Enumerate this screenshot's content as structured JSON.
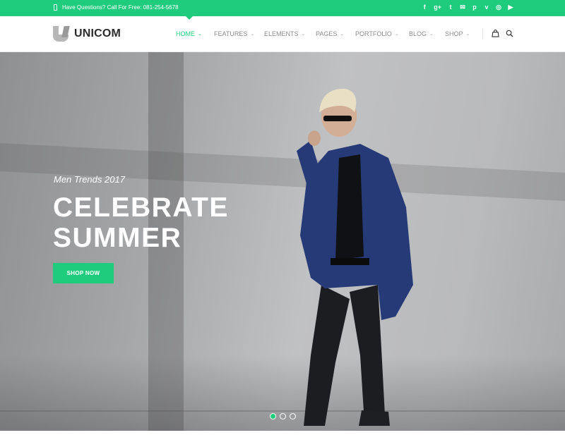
{
  "topbar": {
    "contact_text": "Have Questions? Call For Free: 081-254-5678",
    "socials": [
      {
        "name": "facebook-icon",
        "glyph": "f"
      },
      {
        "name": "google-plus-icon",
        "glyph": "g+"
      },
      {
        "name": "twitter-icon",
        "glyph": "t"
      },
      {
        "name": "email-icon",
        "glyph": "✉"
      },
      {
        "name": "pinterest-icon",
        "glyph": "p"
      },
      {
        "name": "vimeo-icon",
        "glyph": "v"
      },
      {
        "name": "dribbble-icon",
        "glyph": "◎"
      },
      {
        "name": "youtube-icon",
        "glyph": "▶"
      }
    ]
  },
  "header": {
    "logo_text": "UNICOM",
    "nav": [
      {
        "label": "Home",
        "active": true
      },
      {
        "label": "Features",
        "active": false
      },
      {
        "label": "Elements",
        "active": false
      },
      {
        "label": "Pages",
        "active": false
      },
      {
        "label": "Portfolio",
        "active": false
      },
      {
        "label": "Blog",
        "active": false
      },
      {
        "label": "Shop",
        "active": false
      }
    ]
  },
  "hero": {
    "subtitle": "Men Trends 2017",
    "title_line1": "CELEBRATE",
    "title_line2": "SUMMER",
    "button_label": "SHOP NOW",
    "slides": 3,
    "active_slide": 1
  },
  "colors": {
    "accent": "#1fcc7e",
    "nav_text": "#8c8c8c",
    "logo_text": "#2b2b2b"
  }
}
